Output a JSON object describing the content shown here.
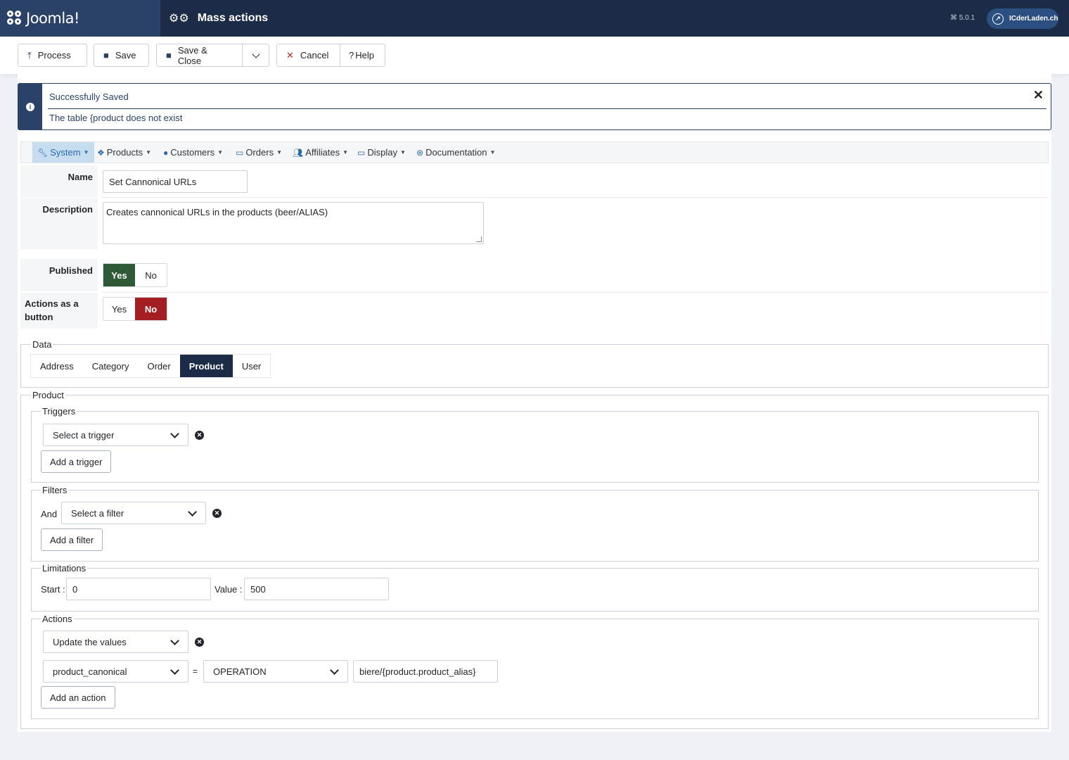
{
  "header": {
    "brand": "Joomla!",
    "title": "Mass actions",
    "version": "5.0.1",
    "site_link": "ICderLaden.ch"
  },
  "toolbar": {
    "process": "Process",
    "save": "Save",
    "save_close": "Save & Close",
    "cancel": "Cancel",
    "help": "Help"
  },
  "alert": {
    "title": "Successfully Saved",
    "message": "The table {product does not exist"
  },
  "menu": {
    "system": "System",
    "products": "Products",
    "customers": "Customers",
    "orders": "Orders",
    "affiliates": "Affiliates",
    "display": "Display",
    "documentation": "Documentation"
  },
  "form": {
    "name_label": "Name",
    "name_value": "Set Cannonical URLs",
    "description_label": "Description",
    "description_value": "Creates cannonical URLs in the products (beer/ALIAS)",
    "published_label": "Published",
    "actions_button_label": "Actions as a button",
    "yes": "Yes",
    "no": "No",
    "published_value": "Yes",
    "actions_button_value": "No"
  },
  "data_section": {
    "legend": "Data",
    "tabs": [
      "Address",
      "Category",
      "Order",
      "Product",
      "User"
    ],
    "active_tab": "Product"
  },
  "product_section": {
    "legend": "Product",
    "triggers": {
      "legend": "Triggers",
      "select": "Select a trigger",
      "add": "Add a trigger"
    },
    "filters": {
      "legend": "Filters",
      "and": "And",
      "select": "Select a filter",
      "add": "Add a filter"
    },
    "limitations": {
      "legend": "Limitations",
      "start_label": "Start :",
      "start_value": "0",
      "value_label": "Value :",
      "value_value": "500"
    },
    "actions": {
      "legend": "Actions",
      "select": "Update the values",
      "field": "product_canonical",
      "equals": "=",
      "operation": "OPERATION",
      "value": "biere/{product.product_alias}",
      "add": "Add an action"
    }
  },
  "colors": {
    "header": "#1c2c46",
    "logo_bg": "#2a4267",
    "yes_active": "#2e5a36",
    "no_active": "#a41e22",
    "menu_active": "#c6ddf0"
  }
}
